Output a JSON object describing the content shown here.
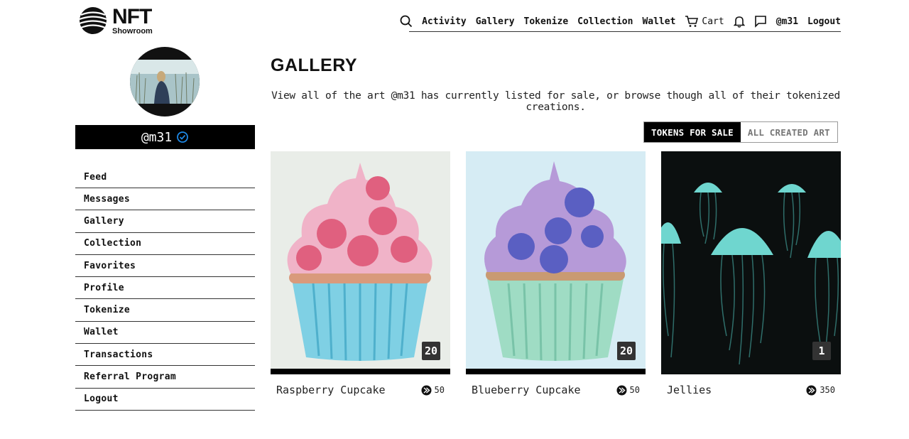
{
  "brand": {
    "big": "NFT",
    "small": "Showroom"
  },
  "topnav": {
    "links": [
      "Activity",
      "Gallery",
      "Tokenize",
      "Collection",
      "Wallet"
    ],
    "cart": "Cart",
    "user": "@m31",
    "logout": "Logout"
  },
  "profile": {
    "username": "@m31"
  },
  "sidebar": {
    "items": [
      "Feed",
      "Messages",
      "Gallery",
      "Collection",
      "Favorites",
      "Profile",
      "Tokenize",
      "Wallet",
      "Transactions",
      "Referral Program",
      "Logout"
    ]
  },
  "main": {
    "title": "GALLERY",
    "subtitle": "View all of the art @m31 has currently listed for sale, or browse though all of their tokenized creations.",
    "toggle": {
      "active": "TOKENS FOR SALE",
      "inactive": "ALL CREATED ART"
    }
  },
  "cards": [
    {
      "name": "Raspberry Cupcake",
      "price": "50",
      "count": "20"
    },
    {
      "name": "Blueberry Cupcake",
      "price": "50",
      "count": "20"
    },
    {
      "name": "Jellies",
      "price": "350",
      "count": "1"
    }
  ],
  "colors": {
    "accent": "#1e88e5",
    "dark": "#000000"
  }
}
